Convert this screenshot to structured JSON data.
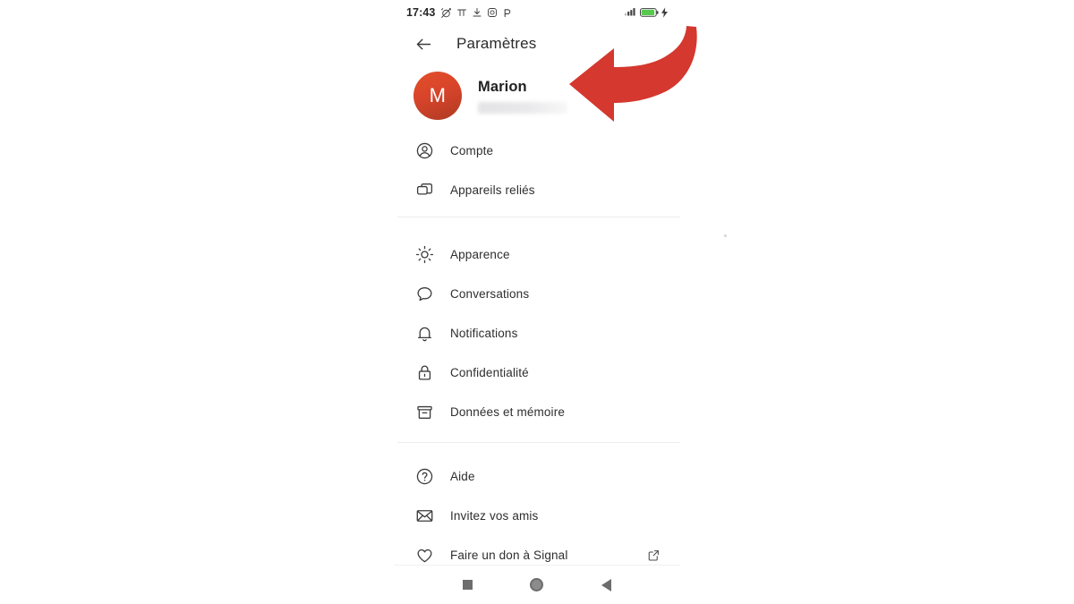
{
  "statusbar": {
    "clock": "17:43",
    "left_icons": [
      "alarm-off-icon",
      "pi-icon",
      "download-icon",
      "instagram-icon",
      "p-icon"
    ],
    "right_icons": [
      "signal-bars-icon",
      "battery-icon",
      "charging-bolt-icon"
    ],
    "battery_color": "#57c94e",
    "battery_level": 82
  },
  "appbar": {
    "back_icon": "back-arrow-icon",
    "title": "Paramètres"
  },
  "profile": {
    "avatar_initial": "M",
    "avatar_color": "#d8442a",
    "name": "Marion",
    "subtitle_redacted": ""
  },
  "groups": [
    {
      "id": "account-group",
      "items": [
        {
          "icon": "account-circle-icon",
          "label": "Compte"
        },
        {
          "icon": "linked-devices-icon",
          "label": "Appareils reliés"
        }
      ]
    },
    {
      "id": "preferences-group",
      "items": [
        {
          "icon": "brightness-sun-icon",
          "label": "Apparence"
        },
        {
          "icon": "chat-bubble-icon",
          "label": "Conversations"
        },
        {
          "icon": "bell-icon",
          "label": "Notifications"
        },
        {
          "icon": "lock-icon",
          "label": "Confidentialité"
        },
        {
          "icon": "archive-box-icon",
          "label": "Données et mémoire"
        }
      ]
    },
    {
      "id": "support-group",
      "items": [
        {
          "icon": "help-circle-icon",
          "label": "Aide"
        },
        {
          "icon": "envelope-icon",
          "label": "Invitez vos amis"
        },
        {
          "icon": "heart-icon",
          "label": "Faire un don à Signal",
          "trailing_icon": "external-link-icon"
        }
      ]
    }
  ],
  "navbar": {
    "recents_label": "recents-square",
    "home_label": "home-circle",
    "back_label": "back-triangle"
  },
  "annotation": {
    "arrow_color": "#d4382f",
    "arrow_name": "red-curved-arrow"
  }
}
